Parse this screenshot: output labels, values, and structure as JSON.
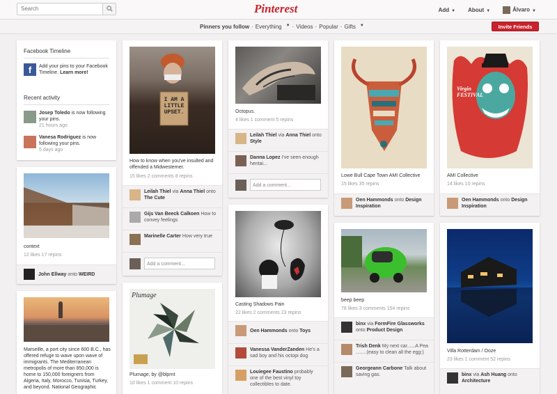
{
  "topbar": {
    "search_placeholder": "Search",
    "logo": "Pinterest",
    "add": "Add",
    "about": "About",
    "user": "Álvaro"
  },
  "subnav": {
    "following": "Pinners you follow",
    "everything": "Everything",
    "videos": "Videos",
    "popular": "Popular",
    "gifts": "Gifts",
    "invite": "Invite Friends"
  },
  "sidebar": {
    "fb_title": "Facebook Timeline",
    "fb_text_a": "Add your pins to your",
    "fb_text_b": "Facebook Timeline.",
    "fb_learn": "Learn more!",
    "recent_title": "Recent activity",
    "act1_name": "Josep Toledo",
    "act1_text": " is now following your pins.",
    "act1_time": "21 hours ago",
    "act2_name": "Vanesa Rodriguez",
    "act2_text": " is now following your pins.",
    "act2_time": "5 days ago"
  },
  "col1": {
    "pin1": {
      "desc": "context",
      "stats": "12 likes   17 repins",
      "via_name": "John Ellway",
      "via_onto": " onto ",
      "board": "WEIRD"
    },
    "pin2": {
      "desc": "Marseille, a port city since 600 B.C., has offered refuge to wave upon wave of immigrants. The Mediterranean metropolis of more than 850,000 is home to 150,000 foreigners from Algeria, Italy, Morocco, Tunisia, Turkey, and beyond. National Geographic"
    }
  },
  "col2": {
    "pin1": {
      "sign": "I AM A LITTLE UPSET.",
      "desc": "How to know when you've insulted and offended a Midwesterner.",
      "stats": "15 likes   2 comments   8 repins",
      "c1_name": "Leilah Thiel",
      "c1_via": " via ",
      "c1_via_name": "Anna Thiel",
      "c1_onto": " onto ",
      "c1_board": "The Cute",
      "c2_name": "Gijs Van Beeck Calkoen",
      "c2_text": " How to convey feelings",
      "c3_name": "Marinelle Carter",
      "c3_text": " How very true",
      "comment_placeholder": "Add a comment..."
    },
    "pin2": {
      "title_art": "Plumage",
      "desc": "Plumage, by @blprnt",
      "stats": "10 likes   1 comment   10 repins"
    }
  },
  "col3": {
    "pin1": {
      "desc": "Octopus.",
      "stats": "4 likes   1 comment   5 repins",
      "c1_name": "Leilah Thiel",
      "c1_via": " via ",
      "c1_via_name": "Anna Thiel",
      "c1_onto": " onto ",
      "c1_board": "Style",
      "c2_name": "Danna Lopez",
      "c2_text": " I've seen enough hentai...",
      "comment_placeholder": "Add a comment..."
    },
    "pin2": {
      "desc": "Casting Shadows Pain",
      "stats": "22 likes   2 comments   23 repins",
      "c1_name": "Oen Hammonds",
      "c1_onto": " onto ",
      "c1_board": "Toys",
      "c2_name": "Vanessa VanderZanden",
      "c2_text": " He's a sad boy and his octopi dog",
      "c3_name": "Louiegee Faustino",
      "c3_text": " probably one of the best vinyl toy collectibles to date."
    }
  },
  "col4": {
    "pin1": {
      "desc": "Lowe Bull Cape Town AMI Collective",
      "stats": "15 likes   35 repins",
      "via_name": "Oen Hammonds",
      "via_onto": " onto ",
      "board": "Design Inspiration"
    },
    "pin2": {
      "desc": "beep beep",
      "stats": "78 likes   3 comments   154 repins",
      "c1_name": "binx",
      "c1_via": " via ",
      "c1_via_name": "FormFire Glassworks",
      "c1_onto": " onto ",
      "c1_board": "Product Design",
      "c2_name": "Trish Denk",
      "c2_text": " My next car......A Pea ........(easy to clean all the egg:)",
      "c3_name": "Georgeann Carbone",
      "c3_text": " Talk about saving gas."
    }
  },
  "col5": {
    "pin1": {
      "desc": "AMI Collective",
      "stats": "14 likes   10 repins",
      "via_name": "Oen Hammonds",
      "via_onto": " onto ",
      "board": "Design Inspiration",
      "festival": "Virgin FESTIVAL"
    },
    "pin2": {
      "desc": "Villa Rotterdam / Ooze",
      "stats": "23 likes   1 comment   52 repins",
      "via_name": "binx",
      "via_via": " via ",
      "via_via_name": "Ash Huang",
      "via_onto": " onto ",
      "board": "Architecture"
    }
  },
  "colors": {
    "brand": "#c8232c",
    "background": "#f2f0f0"
  }
}
